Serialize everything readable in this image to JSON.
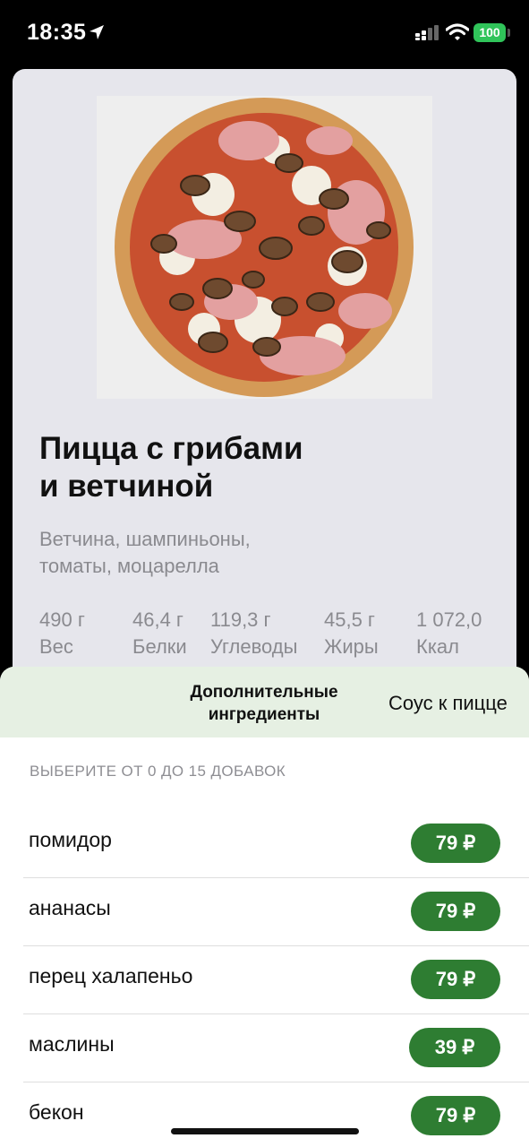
{
  "status_bar": {
    "time": "18:35",
    "battery": "100",
    "icons": [
      "location-arrow-icon",
      "signal-icon",
      "wifi-icon",
      "battery-icon"
    ]
  },
  "product": {
    "title_line1": "Пицца с грибами",
    "title_line2": "и ветчиной",
    "description_line1": "Ветчина, шампиньоны,",
    "description_line2": "томаты, моцарелла",
    "nutrition": [
      {
        "value": "490 г",
        "label": "Вес"
      },
      {
        "value": "46,4 г",
        "label": "Белки"
      },
      {
        "value": "119,3 г",
        "label": "Углеводы"
      },
      {
        "value": "45,5 г",
        "label": "Жиры"
      },
      {
        "value": "1 072,0",
        "label": "Ккал"
      }
    ]
  },
  "sheet": {
    "tabs": [
      {
        "label_line1": "Дополнительные",
        "label_line2": "ингредиенты",
        "active": true
      },
      {
        "label": "Соус к пицце",
        "active": false
      }
    ],
    "hint": "ВЫБЕРИТЕ ОТ 0 ДО 15 ДОБАВОК",
    "items": [
      {
        "name": "помидор",
        "price": "79 ₽"
      },
      {
        "name": "ананасы",
        "price": "79 ₽"
      },
      {
        "name": "перец халапеньо",
        "price": "79 ₽"
      },
      {
        "name": "маслины",
        "price": "39 ₽"
      },
      {
        "name": "бекон",
        "price": "79 ₽"
      }
    ]
  },
  "colors": {
    "accent_green": "#2e7d32",
    "tab_bg": "#e6f0e3",
    "card_bg": "#e6e6ec"
  }
}
